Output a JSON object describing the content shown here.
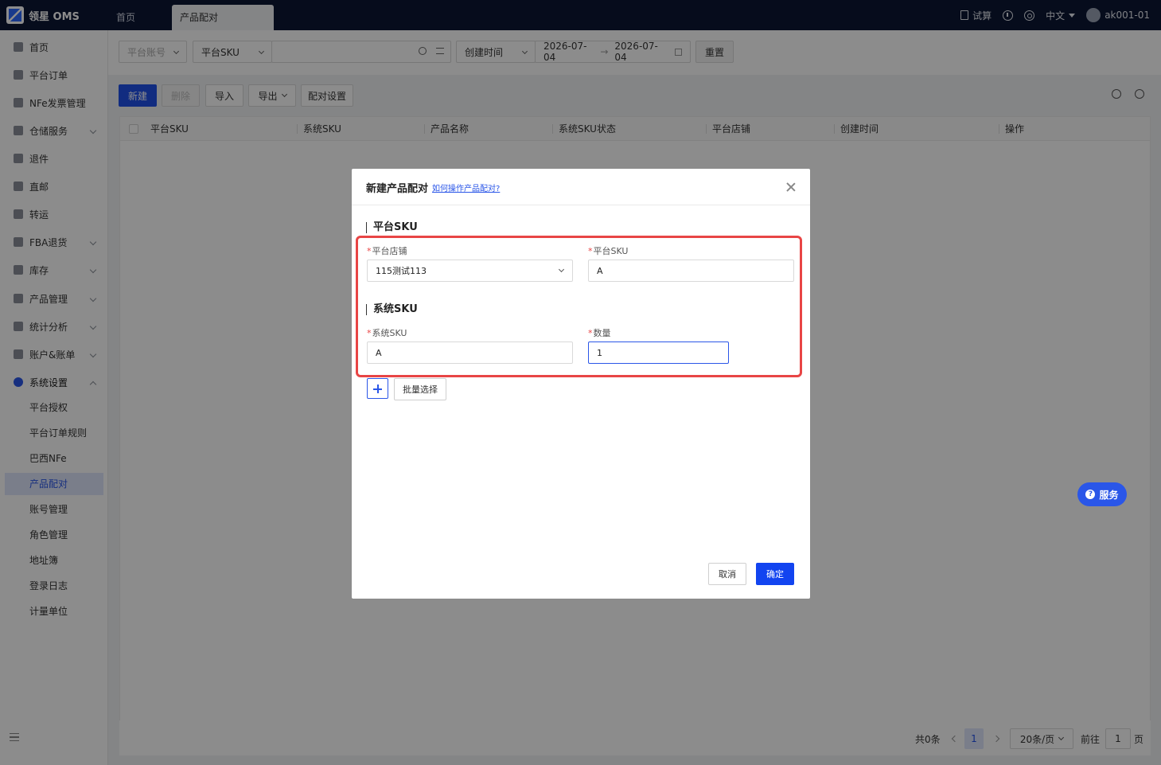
{
  "app": {
    "logo_text": "领星 OMS"
  },
  "tabs": [
    {
      "label": "首页"
    },
    {
      "label": "产品配对"
    }
  ],
  "topbar": {
    "trial_label": "试算",
    "language": "中文",
    "username": "ak001-01"
  },
  "sidebar": {
    "items": [
      {
        "label": "首页"
      },
      {
        "label": "平台订单"
      },
      {
        "label": "NFe发票管理"
      },
      {
        "label": "仓储服务"
      },
      {
        "label": "退件"
      },
      {
        "label": "直邮"
      },
      {
        "label": "转运"
      },
      {
        "label": "FBA退货"
      },
      {
        "label": "库存"
      },
      {
        "label": "产品管理"
      },
      {
        "label": "统计分析"
      },
      {
        "label": "账户&账单"
      },
      {
        "label": "系统设置"
      }
    ],
    "sub_items": [
      {
        "label": "平台授权"
      },
      {
        "label": "平台订单规则"
      },
      {
        "label": "巴西NFe"
      },
      {
        "label": "产品配对"
      },
      {
        "label": "账号管理"
      },
      {
        "label": "角色管理"
      },
      {
        "label": "地址簿"
      },
      {
        "label": "登录日志"
      },
      {
        "label": "计量单位"
      }
    ]
  },
  "filters": {
    "platform_account_placeholder": "平台账号",
    "sku_type": "平台SKU",
    "time_type": "创建时间",
    "date_start": "2026-07-04",
    "date_end": "2026-07-04",
    "reset_label": "重置"
  },
  "toolbar": {
    "new_label": "新建",
    "delete_label": "删除",
    "import_label": "导入",
    "export_label": "导出",
    "settings_label": "配对设置"
  },
  "table": {
    "columns": [
      "平台SKU",
      "系统SKU",
      "产品名称",
      "系统SKU状态",
      "平台店铺",
      "创建时间",
      "操作"
    ]
  },
  "pager": {
    "total": "共0条",
    "current_page": "1",
    "page_size": "20条/页",
    "goto_label": "前往",
    "goto_value": "1",
    "page_suffix": "页"
  },
  "service_label": "服务",
  "modal": {
    "title": "新建产品配对",
    "help_link": "如何操作产品配对?",
    "section_platform": "平台SKU",
    "store_label": "平台店铺",
    "store_value": "115测试113",
    "platform_sku_label": "平台SKU",
    "platform_sku_value": "A",
    "section_system": "系统SKU",
    "system_sku_label": "系统SKU",
    "system_sku_value": "A",
    "quantity_label": "数量",
    "quantity_value": "1",
    "batch_select_label": "批量选择",
    "cancel_label": "取消",
    "confirm_label": "确定"
  }
}
